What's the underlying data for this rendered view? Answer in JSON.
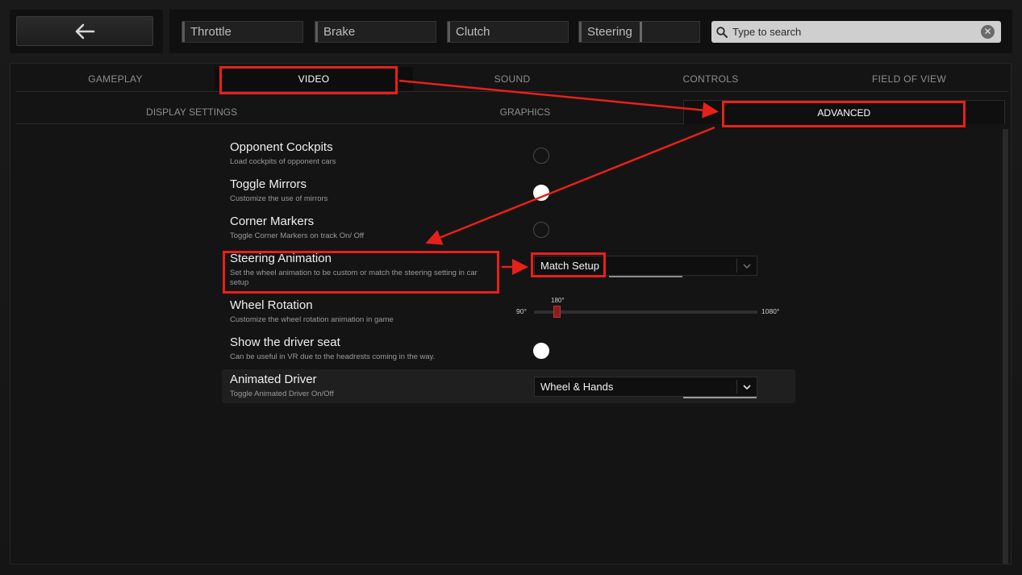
{
  "top_bar": {
    "inputs": [
      {
        "label": "Throttle"
      },
      {
        "label": "Brake"
      },
      {
        "label": "Clutch"
      },
      {
        "label": "Steering"
      }
    ],
    "search_placeholder": "Type to search"
  },
  "tabs": [
    {
      "label": "GAMEPLAY"
    },
    {
      "label": "VIDEO"
    },
    {
      "label": "SOUND"
    },
    {
      "label": "CONTROLS"
    },
    {
      "label": "FIELD OF VIEW"
    }
  ],
  "subtabs": [
    {
      "label": "DISPLAY SETTINGS"
    },
    {
      "label": "GRAPHICS"
    },
    {
      "label": "ADVANCED"
    }
  ],
  "settings": {
    "opponent_cockpits": {
      "title": "Opponent Cockpits",
      "desc": "Load cockpits of opponent cars"
    },
    "toggle_mirrors": {
      "title": "Toggle Mirrors",
      "desc": "Customize the use of mirrors"
    },
    "corner_markers": {
      "title": "Corner Markers",
      "desc": "Toggle Corner Markers on track On/ Off"
    },
    "steering_animation": {
      "title": "Steering Animation",
      "desc": "Set the wheel animation to be custom or match the steering setting in car setup",
      "value": "Match Setup"
    },
    "wheel_rotation": {
      "title": "Wheel Rotation",
      "desc": "Customize the wheel rotation animation in game",
      "min_label": "90°",
      "max_label": "1080°",
      "value_label": "180°",
      "value": 180
    },
    "driver_seat": {
      "title": "Show the driver seat",
      "desc": "Can be useful in VR due to the headrests coming in the way."
    },
    "animated_driver": {
      "title": "Animated Driver",
      "desc": "Toggle Animated Driver On/Off",
      "value": "Wheel & Hands"
    }
  },
  "colors": {
    "annotation": "#e8201a",
    "accent": "#8b1d1d"
  }
}
